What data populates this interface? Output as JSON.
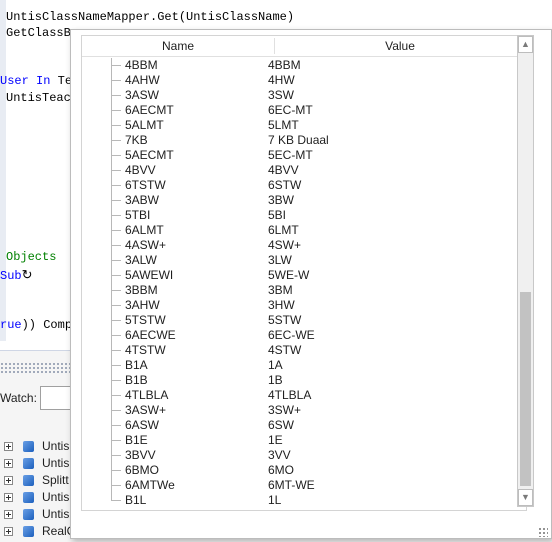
{
  "editor": {
    "line1": "UntisClassNameMapper.Get(UntisClassName)",
    "line2": "GetClassB",
    "line3_kw1": "User",
    "line3_kw2": "In",
    "line3_rest": "Te",
    "line4": "UntisTeac",
    "line5": "Objects",
    "line6_kw": "Sub",
    "line7_kw": "rue",
    "line7_rest": ")) Comp"
  },
  "watch_panel": {
    "label": "Watch:",
    "items": [
      "Untis",
      "Untis",
      "Splitt",
      "Untis",
      "Untis",
      "RealC"
    ]
  },
  "popup": {
    "columns": {
      "name": "Name",
      "value": "Value"
    },
    "rows": [
      {
        "name": "4BBM",
        "value": "4BBM"
      },
      {
        "name": "4AHW",
        "value": "4HW"
      },
      {
        "name": "3ASW",
        "value": "3SW"
      },
      {
        "name": "6AECMT",
        "value": "6EC-MT"
      },
      {
        "name": "5ALMT",
        "value": "5LMT"
      },
      {
        "name": "7KB",
        "value": "7 KB Duaal"
      },
      {
        "name": "5AECMT",
        "value": "5EC-MT"
      },
      {
        "name": "4BVV",
        "value": "4BVV"
      },
      {
        "name": "6TSTW",
        "value": "6STW"
      },
      {
        "name": "3ABW",
        "value": "3BW"
      },
      {
        "name": "5TBI",
        "value": "5BI"
      },
      {
        "name": "6ALMT",
        "value": "6LMT"
      },
      {
        "name": "4ASW+",
        "value": "4SW+"
      },
      {
        "name": "3ALW",
        "value": "3LW"
      },
      {
        "name": "5AWEWI",
        "value": "5WE-W"
      },
      {
        "name": "3BBM",
        "value": "3BM"
      },
      {
        "name": "3AHW",
        "value": "3HW"
      },
      {
        "name": "5TSTW",
        "value": "5STW"
      },
      {
        "name": "6AECWE",
        "value": "6EC-WE"
      },
      {
        "name": "4TSTW",
        "value": "4STW"
      },
      {
        "name": "B1A",
        "value": "1A"
      },
      {
        "name": "B1B",
        "value": "1B"
      },
      {
        "name": "4TLBLA",
        "value": "4TLBLA"
      },
      {
        "name": "3ASW+",
        "value": "3SW+"
      },
      {
        "name": "6ASW",
        "value": "6SW"
      },
      {
        "name": "B1E",
        "value": "1E"
      },
      {
        "name": "3BVV",
        "value": "3VV"
      },
      {
        "name": "6BMO",
        "value": "6MO"
      },
      {
        "name": "6AMTWe",
        "value": "6MT-WE"
      },
      {
        "name": "B1L",
        "value": "1L"
      }
    ],
    "scroll_position": 0.55
  },
  "colors": {
    "keyword": "#0000ff",
    "comment": "#008000"
  }
}
